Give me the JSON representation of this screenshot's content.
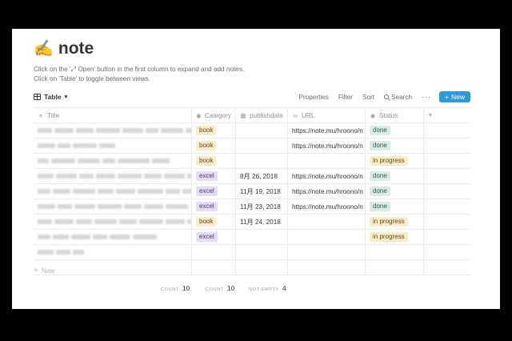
{
  "page": {
    "emoji": "✍️",
    "title": "note"
  },
  "description": [
    "Click on the '⤢ Open' button in the first column to expand and add notes.",
    "Click on 'Table' to toggle between views."
  ],
  "view_bar": {
    "view_label": "Table",
    "tools": [
      "Properties",
      "Filter",
      "Sort"
    ],
    "search_label": "Search",
    "more_label": "···",
    "new_label": "New"
  },
  "columns": {
    "title": "Title",
    "category": "Category",
    "publishdate": "publishdate",
    "url": "URL",
    "status": "Status",
    "add": "+"
  },
  "rows": [
    {
      "category": "book",
      "publishdate": "",
      "url": "https://note.mu/hroono/n",
      "status": "done"
    },
    {
      "category": "book",
      "publishdate": "",
      "url": "https://note.mu/hroono/n",
      "status": "done"
    },
    {
      "category": "book",
      "publishdate": "",
      "url": "",
      "status": "in progress"
    },
    {
      "category": "excel",
      "publishdate": "8月 26, 2018",
      "url": "https://note.mu/hroono/n",
      "status": "done"
    },
    {
      "category": "excel",
      "publishdate": "11月 19, 2018",
      "url": "https://note.mu/hroono/n",
      "status": "done"
    },
    {
      "category": "excel",
      "publishdate": "11月 23, 2018",
      "url": "https://note.mu/hroono/n",
      "status": "done"
    },
    {
      "category": "book",
      "publishdate": "11月 24, 2018",
      "url": "",
      "status": "in progress"
    },
    {
      "category": "excel",
      "publishdate": "",
      "url": "",
      "status": "in progress"
    },
    {
      "category": "",
      "publishdate": "",
      "url": "",
      "status": ""
    },
    {
      "category": "",
      "publishdate": "",
      "url": "",
      "status": ""
    }
  ],
  "new_row_label": "New",
  "calculations": [
    {
      "label": "COUNT",
      "value": "10"
    },
    {
      "label": "COUNT",
      "value": "10"
    },
    {
      "label": "NOT EMPTY",
      "value": "4"
    }
  ],
  "colors": {
    "accent": "#2e9ad8",
    "tag_book": "#fbecc9",
    "tag_excel": "#e6dcf5",
    "tag_done": "#d8ece3"
  }
}
